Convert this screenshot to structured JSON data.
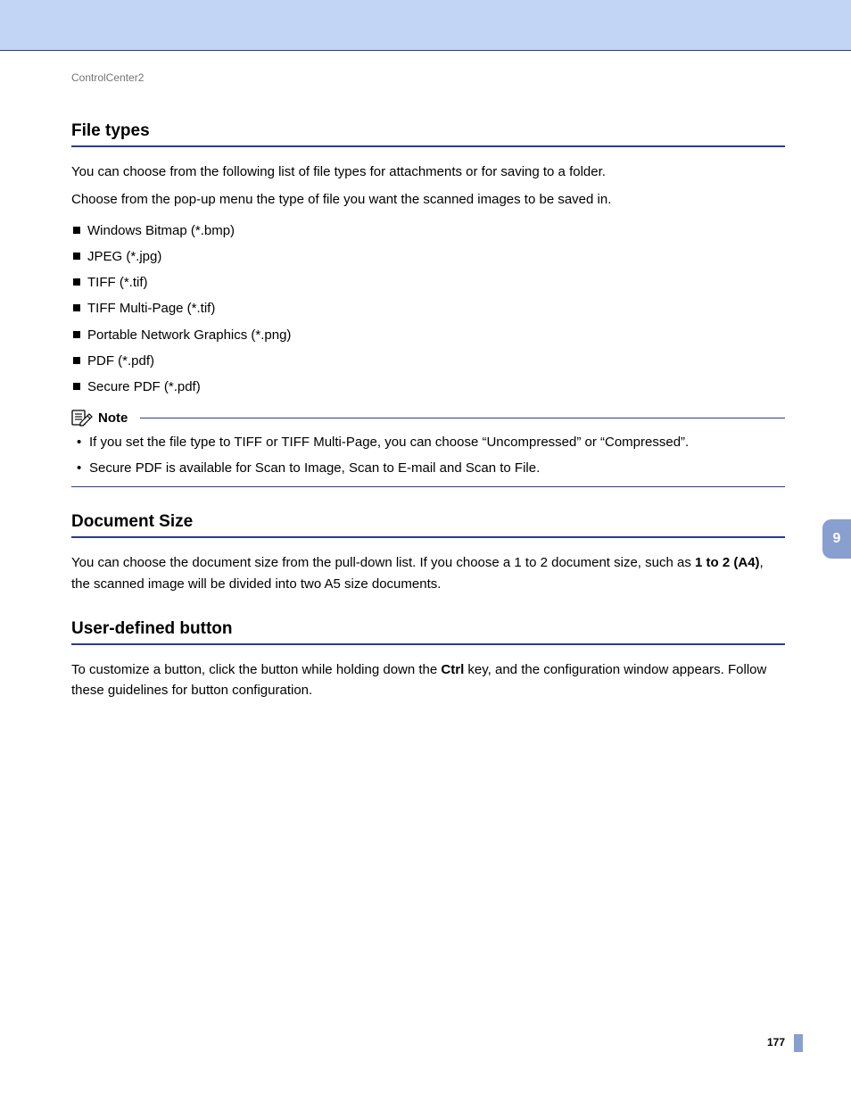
{
  "breadcrumb": "ControlCenter2",
  "chapter_tab": "9",
  "page_number": "177",
  "sections": {
    "file_types": {
      "heading": "File types",
      "para1": "You can choose from the following list of file types for attachments or for saving to a folder.",
      "para2": "Choose from the pop-up menu the type of file you want the scanned images to be saved in.",
      "items": [
        "Windows Bitmap (*.bmp)",
        "JPEG (*.jpg)",
        "TIFF (*.tif)",
        "TIFF Multi-Page (*.tif)",
        "Portable Network Graphics (*.png)",
        "PDF (*.pdf)",
        "Secure PDF (*.pdf)"
      ],
      "note_label": "Note",
      "note_items": [
        "If you set the file type to TIFF or TIFF Multi-Page, you can choose “Uncompressed” or “Compressed”.",
        "Secure PDF is available for Scan to Image, Scan to E-mail and Scan to File."
      ]
    },
    "document_size": {
      "heading": "Document Size",
      "para_pre": "You can choose the document size from the pull-down list. If you choose a 1 to 2 document size, such as ",
      "para_bold": "1 to 2 (A4)",
      "para_post": ", the scanned image will be divided into two A5 size documents."
    },
    "user_defined_button": {
      "heading": "User-defined button",
      "para_pre": "To customize a button, click the button while holding down the ",
      "para_bold": "Ctrl",
      "para_post": " key, and the configuration window appears. Follow these guidelines for button configuration."
    }
  }
}
